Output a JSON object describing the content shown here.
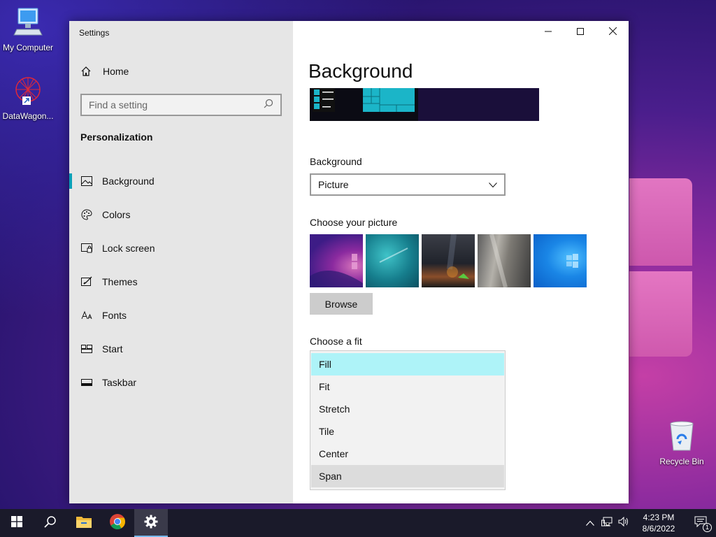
{
  "desktop": {
    "icons": [
      {
        "label": "My Computer"
      },
      {
        "label": "DataWagon..."
      },
      {
        "label": "Recycle Bin"
      }
    ]
  },
  "window": {
    "app_title": "Settings",
    "controls": {
      "minimize": "minimize",
      "maximize": "maximize",
      "close": "close"
    }
  },
  "sidebar": {
    "home_label": "Home",
    "search_placeholder": "Find a setting",
    "section_title": "Personalization",
    "items": [
      {
        "label": "Background",
        "icon": "picture-icon",
        "active": true
      },
      {
        "label": "Colors",
        "icon": "palette-icon"
      },
      {
        "label": "Lock screen",
        "icon": "lock-screen-icon"
      },
      {
        "label": "Themes",
        "icon": "themes-icon"
      },
      {
        "label": "Fonts",
        "icon": "fonts-icon"
      },
      {
        "label": "Start",
        "icon": "start-icon"
      },
      {
        "label": "Taskbar",
        "icon": "taskbar-icon"
      }
    ]
  },
  "main": {
    "title": "Background",
    "background_label": "Background",
    "background_value": "Picture",
    "choose_picture_label": "Choose your picture",
    "browse_label": "Browse",
    "choose_fit_label": "Choose a fit",
    "fit_options": [
      "Fill",
      "Fit",
      "Stretch",
      "Tile",
      "Center",
      "Span"
    ],
    "fit_selected": "Fill",
    "fit_hovered": "Span"
  },
  "taskbar": {
    "time": "4:23 PM",
    "date": "8/6/2022",
    "notification_count": "1",
    "accent_color": "#76b9ed"
  }
}
